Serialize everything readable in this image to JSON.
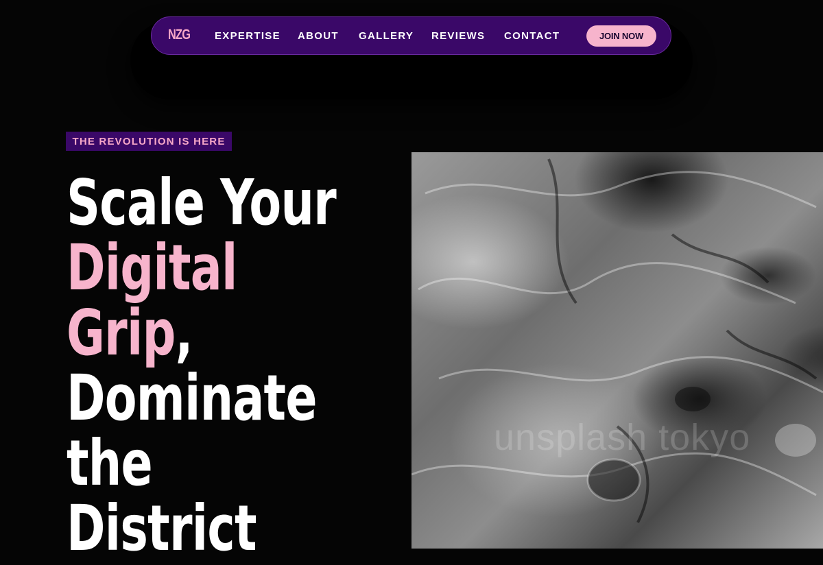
{
  "nav": {
    "logo": "NZG",
    "links": [
      "EXPERTISE",
      "ABOUT",
      "GALLERY",
      "REVIEWS",
      "CONTACT"
    ],
    "cta": "JOIN NOW"
  },
  "hero": {
    "tag": "THE REVOLUTION IS HERE",
    "headline": {
      "line1": "Scale Your",
      "line2": "Digital",
      "line3_pink": "Grip",
      "line3_rest": ",",
      "line4": "Dominate",
      "line5": "the",
      "line6": "District"
    },
    "image": {
      "watermark": "unsplash tokyo"
    }
  },
  "colors": {
    "background": "#050505",
    "nav": "#3a0868",
    "accent_pink": "#f7b4cc"
  }
}
